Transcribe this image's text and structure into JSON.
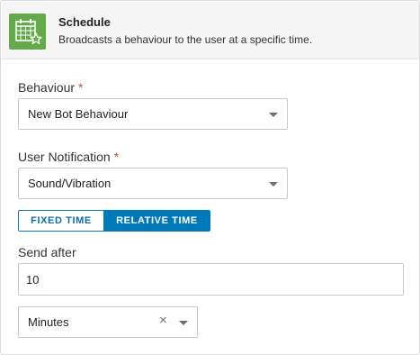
{
  "header": {
    "icon": "calendar-star-icon",
    "title": "Schedule",
    "subtitle": "Broadcasts a behaviour to the user at a specific time.",
    "icon_color": "#64a94a"
  },
  "behaviour": {
    "label": "Behaviour",
    "required_mark": "*",
    "value": "New Bot Behaviour"
  },
  "notification": {
    "label": "User Notification",
    "required_mark": "*",
    "value": "Sound/Vibration"
  },
  "time_mode": {
    "options": [
      "FIXED TIME",
      "RELATIVE TIME"
    ],
    "selected": "RELATIVE TIME",
    "accent_color": "#0079b8"
  },
  "send_after": {
    "label": "Send after",
    "value": "10",
    "unit": "Minutes",
    "clear_symbol": "×"
  },
  "colors": {
    "required": "#d04c3a",
    "header_bg": "#f5f5f5"
  }
}
